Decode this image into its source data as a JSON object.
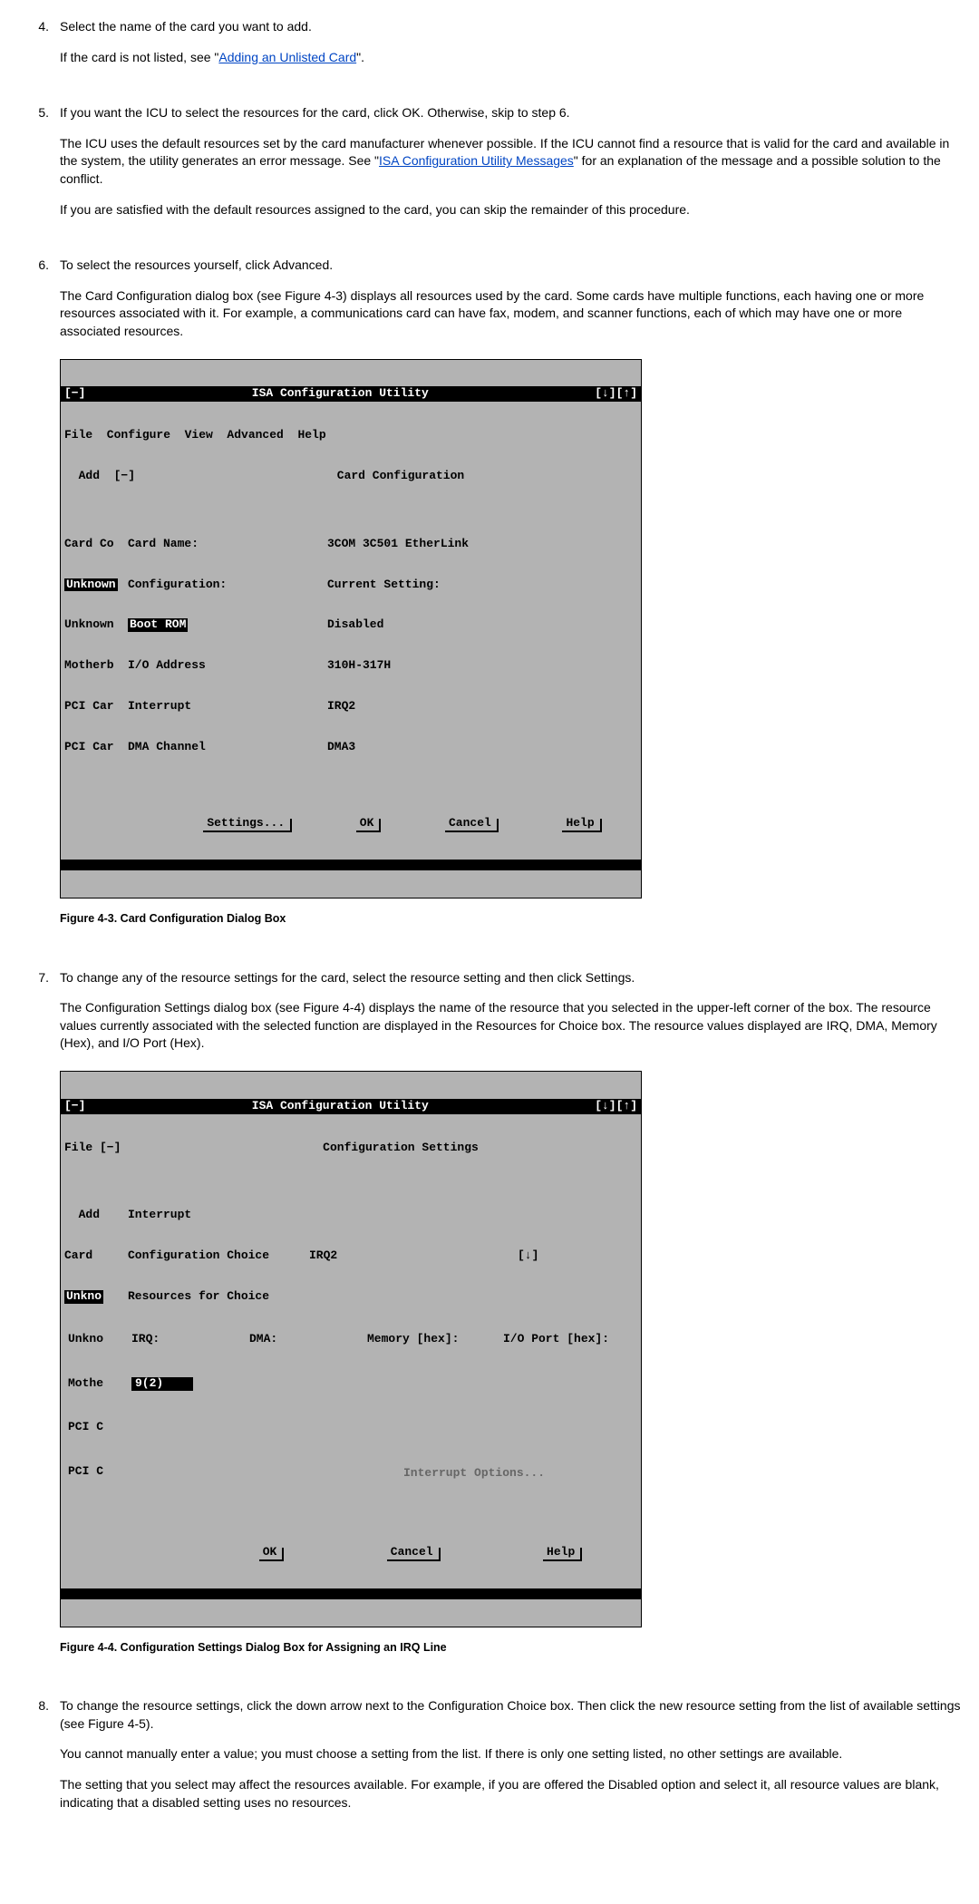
{
  "steps": {
    "s4": {
      "num": "4.",
      "p1": "Select the name of the card you want to add.",
      "p2a": "If the card is not listed, see \"",
      "p2link": "Adding an Unlisted Card",
      "p2b": "\"."
    },
    "s5": {
      "num": "5.",
      "p1": "If you want the ICU to select the resources for the card, click OK. Otherwise, skip to step 6.",
      "p2a": "The ICU uses the default resources set by the card manufacturer whenever possible. If the ICU cannot find a resource that is valid for the card and available in the system, the utility generates an error message. See \"",
      "p2link": "ISA Configuration Utility Messages",
      "p2b": "\" for an explanation of the message and a possible solution to the conflict.",
      "p3": "If you are satisfied with the default resources assigned to the card, you can skip the remainder of this procedure."
    },
    "s6": {
      "num": "6.",
      "p1": "To select the resources yourself, click Advanced.",
      "p2": "The Card Configuration dialog box (see Figure 4-3) displays all resources used by the card. Some cards have multiple functions, each having one or more resources associated with it. For example, a communications card can have fax, modem, and scanner functions, each of which may have one or more associated resources."
    },
    "s7": {
      "num": "7.",
      "p1": "To change any of the resource settings for the card, select the resource setting and then click Settings.",
      "p2": "The Configuration Settings dialog box (see Figure 4-4) displays the name of the resource that you selected in the upper-left corner of the box. The resource values currently associated with the selected function are displayed in the Resources for Choice box. The resource values displayed are IRQ, DMA, Memory (Hex), and I/O Port (Hex)."
    },
    "s8": {
      "num": "8.",
      "p1": "To change the resource settings, click the down arrow next to the Configuration Choice box. Then click the new resource setting from the list of available settings (see Figure 4-5).",
      "p2": "You cannot manually enter a value; you must choose a setting from the list. If there is only one setting listed, no other settings are available.",
      "p3": "The setting that you select may affect the resources available. For example, if you are offered the Disabled option and select it, all resource values are blank, indicating that a disabled setting uses no resources."
    }
  },
  "fig43": {
    "caption": "Figure 4-3. Card Configuration Dialog Box",
    "title_left": "[−]",
    "title_center": "ISA Configuration Utility",
    "title_right": "[↓][↑]",
    "menu": "File  Configure  View  Advanced  Help",
    "sub_lead": "  Add  [−]",
    "sub_center": "Card Configuration",
    "side": [
      "Card Co",
      "Unknown",
      "Unknown",
      "Motherb",
      "PCI Car",
      "PCI Car"
    ],
    "labels": {
      "card_name": "Card Name:",
      "configuration": "Configuration:",
      "boot_rom": "Boot ROM",
      "io_addr": "I/O Address",
      "interrupt": "Interrupt",
      "dma": "DMA Channel",
      "current": "Current Setting:"
    },
    "values": {
      "card_name": "3COM 3C501 EtherLink",
      "boot_rom": "Disabled",
      "io_addr": "310H-317H",
      "interrupt": "IRQ2",
      "dma": "DMA3"
    },
    "buttons": {
      "settings": "Settings...",
      "ok": "OK",
      "cancel": "Cancel",
      "help": "Help"
    }
  },
  "fig44": {
    "caption": "Figure 4-4. Configuration Settings Dialog Box for Assigning an IRQ Line",
    "title_left": "[−]",
    "title_center": "ISA Configuration Utility",
    "title_right": "[↓][↑]",
    "menu": "File [−]",
    "sub_center": "Configuration Settings",
    "side": [
      "  Add",
      "Card",
      "Unkno",
      "Unkno",
      "Mothe",
      "PCI C",
      "PCI C",
      " "
    ],
    "labels": {
      "interrupt": "Interrupt",
      "choice": "Configuration Choice",
      "resources": "Resources for Choice",
      "irq": "IRQ:",
      "dma": "DMA:",
      "memory": "Memory [hex]:",
      "ioport": "I/O Port [hex]:",
      "int_opt": "Interrupt Options..."
    },
    "values": {
      "choice": "IRQ2",
      "dropdown_mark": "[↓]",
      "irq_sel": "9(2)"
    },
    "buttons": {
      "ok": "OK",
      "cancel": "Cancel",
      "help": "Help"
    }
  }
}
